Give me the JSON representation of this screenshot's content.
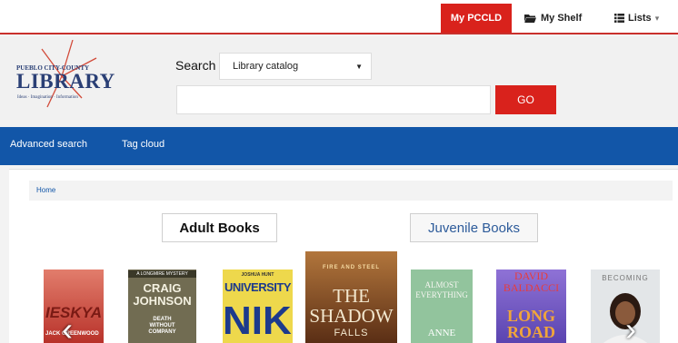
{
  "topbar": {
    "my_pccld": "My PCCLD",
    "my_shelf": "My Shelf",
    "lists": "Lists"
  },
  "logo": {
    "top_line": "PUEBLO CITY-COUNTY",
    "main": "LIBRARY",
    "tagline": "Ideas · Imagination · Information"
  },
  "search": {
    "label": "Search",
    "scope_selected": "Library catalog",
    "query_value": "",
    "go_label": "GO"
  },
  "nav": {
    "items": [
      {
        "label": "Advanced search"
      },
      {
        "label": "Tag cloud"
      }
    ]
  },
  "breadcrumb": {
    "home": "Home"
  },
  "tabs": [
    {
      "label": "Adult Books"
    },
    {
      "label": "Juvenile Books"
    }
  ],
  "covers": [
    {
      "title": "IESKYA",
      "author": "JACK GREENWOOD",
      "color": "#c23a2f"
    },
    {
      "title": "CRAIG JOHNSON",
      "subtitle": "DEATH WITHOUT COMPANY",
      "banner": "A LONGMIRE MYSTERY",
      "color": "#6f6a4e"
    },
    {
      "title": "UNIVERSITY",
      "subtitle": "NIKE",
      "author": "JOSHUA HUNT",
      "color": "#ecd64b"
    },
    {
      "title": "THE SHADOW",
      "subtitle": "FALLS",
      "banner": "FIRE AND STEEL",
      "color": "#6b3a1f"
    },
    {
      "title": "ALMOST EVERYTHING",
      "subtitle": "ANNE",
      "color": "#8fc19a"
    },
    {
      "title": "DAVID BALDACCI",
      "subtitle": "LONG ROAD",
      "color": "#7a5ec9"
    },
    {
      "title": "BECOMING",
      "color": "#dfe3e6"
    }
  ],
  "carousel": {
    "prev_icon": "chevron-left-icon",
    "next_icon": "chevron-right-icon"
  },
  "colors": {
    "accent_red": "#d9221c",
    "nav_blue": "#1256a8"
  }
}
